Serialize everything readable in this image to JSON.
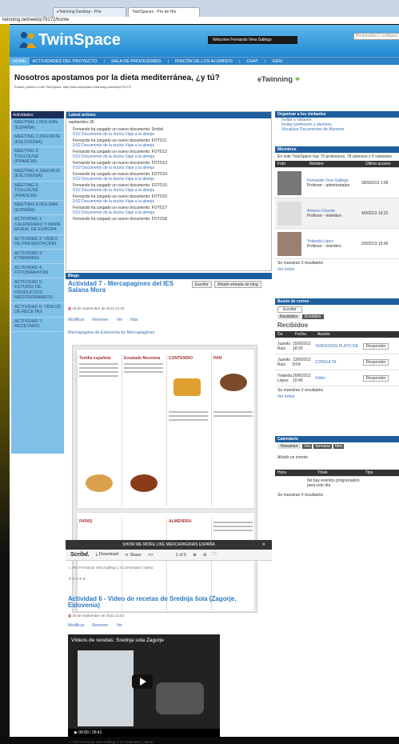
{
  "browser": {
    "tabs": [
      "eTwinning Desktop - Prin",
      "TwinSpaces - Pro de Hor"
    ],
    "url": "twinning.net/web/p79172/home"
  },
  "header": {
    "app_title": "TwinSpace",
    "welcome": "Welcome Fernando Vera Gallego",
    "search_placeholder": "Personaliza y configura"
  },
  "nav": [
    "HOME",
    "ACTIVIDADES DEL PROYECTO",
    "SALA DE PROFESORES",
    "RINCÓN DE LOS ALUMNOS",
    "CHAT",
    "GEM"
  ],
  "page": {
    "title": "Nosotros apostamos por la dieta mediterránea, ¿y tú?",
    "link": "Enlace público a este TwinSpace: http://new-twinspace.etwinning.net/web/p79172/",
    "partner": "eTwinning"
  },
  "sidebar": {
    "head": "Actividades",
    "items": [
      "MEETING 1 ROLDÁN (ESPAÑA)",
      "MEETING 2 ZAGORJE (ESLOVENIA)",
      "MEETING 3 TOULOUSE (FRANCIA)",
      "MEETING 4 ZAGORJE (ESLOVENIA)",
      "MEETING 5 TOULOUSE (FRANCIA)",
      "MEETING 6 ROLDÁN (ESPAÑA)",
      "ACTIVIDAD 1: CALENDARIO Y MAPA MURAL DE EUROPA",
      "ACTIVIDAD 2: VÍDEO DE PRESENTACIÓN",
      "ACTIVIDAD 3: ETWINNING",
      "ACTIVIDAD 4: FOTOMARATÓN",
      "ACTIVIDAD 5: ESTUDIO DE PRODUCTOS MEDITERRÁNEOS",
      "ACTIVIDAD 6: VÍDEOS DE RECETAS",
      "ACTIVIDAD 7: RECETARIO"
    ]
  },
  "latest": {
    "head": "Latest actions",
    "date": "septiembre 26",
    "items": [
      {
        "u": "Fernando ha cargado un nuevo documento: Scribd",
        "d": "0:52 Documento de la ducha Viaje a la almeja"
      },
      {
        "u": "Fernando ha cargado un nuevo documento: FOTO11",
        "d": "0:52 Documento de la ducha Viaje a la almeja"
      },
      {
        "u": "Fernando ha cargado un nuevo documento: FOTO12",
        "d": "0:52 Documento de la ducha Viaje a la almeja"
      },
      {
        "u": "Fernando ha cargado un nuevo documento: FOTO13",
        "d": "0:52 Documento de la ducha Viaje a la almeja"
      },
      {
        "u": "Fernando ha cargado un nuevo documento: FOTO14",
        "d": "0:52 Documento de la ducha Viaje a la almeja"
      },
      {
        "u": "Fernando ha cargado un nuevo documento: FOTO15",
        "d": "0:52 Documento de la ducha Viaje a la almeja"
      },
      {
        "u": "Fernando ha cargado un nuevo documento: FOTO16",
        "d": "0:52 Documento de la ducha Viaje a la almeja"
      },
      {
        "u": "Fernando ha cargado un nuevo documento: FOTO17",
        "d": "0:52 Documento de la ducha Viaje a la almeja"
      },
      {
        "u": "Fernando ha cargado un nuevo documento: FOTO18",
        "d": ""
      }
    ]
  },
  "blog": {
    "head": "Blogs",
    "post1": {
      "title": "Actividad 7 - Mercapagines del IES Salana Mora",
      "date": "29 de septiembre de 2013 12:29",
      "btn1": "Escribir",
      "btn2": "Añadir entrada de blog",
      "tools": [
        "Modificar",
        "Remover",
        "Ver",
        "Más"
      ],
      "embed": "Mercapagina de Eslovenia by Mercapaginas",
      "scribd_bar": "SHOW ME MORE LIKE MERCAPAGINAS ESPAÑA",
      "scribd": {
        "logo": "Scribd.",
        "download": "Download",
        "share": "Share",
        "page": "1 of 5"
      },
      "doc_titles": [
        "Tortilla española",
        "Ensalada Murciana",
        "CONTENIDO",
        "PAN",
        "PAPAS",
        "ALMENDRA"
      ],
      "footer": "Por Fernando Vera Gallego | 3 Comentario | Vamo",
      "rating": "★★★★★"
    },
    "post2": {
      "title": "Actividad 6 - Video de recetas de Srednja šola (Zagorje, Eslovenia)",
      "date": "29 de septiembre de 2013 11:52",
      "tools": [
        "Modificar",
        "Remover",
        "Ver"
      ],
      "video_title": "Vídeos de recetas: Srednja sola Zagorje",
      "time": "00:00 / 28:41",
      "footer": "Por Fernando Vera Gallego | 3 Comentario | Vamo"
    }
  },
  "right": {
    "help": {
      "head": "Organizar a los visitantes",
      "links": [
        "Invitar a visitante",
        "Invitar profesores y alumnos",
        "Visualizar Documentos de Alumnos"
      ]
    },
    "members": {
      "head": "Miembros",
      "desc": "En este TwinSpace hay 76 profesores, 78 alumnos y 6 visitantes",
      "cols": [
        "Foto",
        "Nombre",
        "Último acceso"
      ],
      "rows": [
        {
          "name": "Fernando Vera Gallego",
          "role": "Profesor - administrador",
          "last": "28/9/2013 1:08"
        },
        {
          "name": "Antonio Vicente",
          "role": "Profesor - miembro",
          "last": "4/9/2013 19:32"
        },
        {
          "name": "Yolanda López",
          "role": "Profesor - miembro",
          "last": "2/9/2013 15:45"
        }
      ],
      "showing": "Se muestran 3 resultados",
      "more": "Ver todos"
    },
    "messages": {
      "head": "Buzón de correo",
      "compose": "Escribir",
      "received_tab": "Recibidos",
      "sent_tab": "Enviados",
      "title": "Recibidos",
      "cols": [
        "De",
        "Fecha",
        "Asunto"
      ],
      "rows": [
        {
          "from": "Juanito Ruiz",
          "date": "15/9/2013 18:20",
          "subj": "VERDUDOS PLATO DE",
          "act": "Responder"
        },
        {
          "from": "Juanito Ruiz",
          "date": "13/9/2013 8:54",
          "subj": "CONSULTA",
          "act": "Responder"
        },
        {
          "from": "Yolanda López",
          "date": "29/8/2013 10:40",
          "subj": "Vídeo",
          "act": "Responder"
        }
      ],
      "showing": "Se muestran 3 resultados",
      "more": "Ver todos"
    },
    "calendar": {
      "head": "Calendario",
      "tabs": [
        "Resumen",
        "Día",
        "Semana",
        "Mes"
      ],
      "add": "Añadir un evento",
      "cols": [
        "Hora",
        "Título",
        "Tipo"
      ],
      "empty": "No hay eventos programados para este día",
      "showing": "Se muestran 0 resultados"
    }
  }
}
